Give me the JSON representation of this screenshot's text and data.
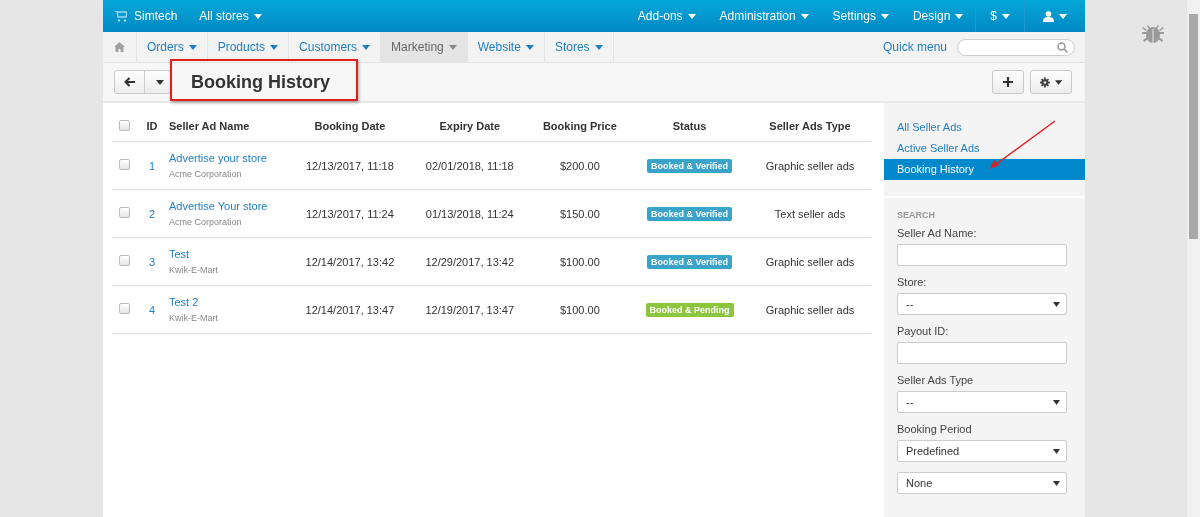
{
  "top_bar": {
    "brand": "Simtech",
    "store_switch": "All stores",
    "menus": [
      "Add-ons",
      "Administration",
      "Settings",
      "Design",
      "$"
    ]
  },
  "nav": {
    "items": [
      {
        "label": "Orders",
        "selected": false
      },
      {
        "label": "Products",
        "selected": false
      },
      {
        "label": "Customers",
        "selected": false
      },
      {
        "label": "Marketing",
        "selected": true
      },
      {
        "label": "Website",
        "selected": false
      },
      {
        "label": "Stores",
        "selected": false
      }
    ],
    "quick_menu": "Quick menu"
  },
  "page": {
    "title": "Booking History"
  },
  "table": {
    "select_all_checked": false,
    "columns": [
      "ID",
      "Seller Ad Name",
      "Booking Date",
      "Expiry Date",
      "Booking Price",
      "Status",
      "Seller Ads Type"
    ],
    "rows": [
      {
        "checked": false,
        "id": "1",
        "name": "Advertise your store",
        "company": "Acme Corporation",
        "booking_date": "12/13/2017, 11:18",
        "expiry_date": "02/01/2018, 11:18",
        "price": "$200.00",
        "status": {
          "label": "Booked & Verified",
          "color": "#3aa3c8"
        },
        "type": "Graphic seller ads"
      },
      {
        "checked": false,
        "id": "2",
        "name": "Advertise Your store",
        "company": "Acme Corporation",
        "booking_date": "12/13/2017, 11:24",
        "expiry_date": "01/13/2018, 11:24",
        "price": "$150.00",
        "status": {
          "label": "Booked & Verified",
          "color": "#3aa3c8"
        },
        "type": "Text seller ads"
      },
      {
        "checked": false,
        "id": "3",
        "name": "Test",
        "company": "Kwik-E-Mart",
        "booking_date": "12/14/2017, 13:42",
        "expiry_date": "12/29/2017, 13:42",
        "price": "$100.00",
        "status": {
          "label": "Booked & Verified",
          "color": "#3aa3c8"
        },
        "type": "Graphic seller ads"
      },
      {
        "checked": false,
        "id": "4",
        "name": "Test 2",
        "company": "Kwik-E-Mart",
        "booking_date": "12/14/2017, 13:47",
        "expiry_date": "12/19/2017, 13:47",
        "price": "$100.00",
        "status": {
          "label": "Booked & Pending",
          "color": "#8cc63f"
        },
        "type": "Graphic seller ads"
      }
    ]
  },
  "sidebar": {
    "links": [
      {
        "label": "All Seller Ads",
        "selected": false
      },
      {
        "label": "Active Seller Ads",
        "selected": false
      },
      {
        "label": "Booking History",
        "selected": true
      }
    ],
    "search": {
      "heading": "SEARCH",
      "fields": [
        {
          "kind": "text",
          "label": "Seller Ad Name:"
        },
        {
          "kind": "select",
          "label": "Store:",
          "value": "--"
        },
        {
          "kind": "text",
          "label": "Payout ID:"
        },
        {
          "kind": "select",
          "label": "Seller Ads Type",
          "value": "--"
        },
        {
          "kind": "select",
          "label": "Booking Period",
          "value": "Predefined"
        },
        {
          "kind": "select",
          "value": "None"
        }
      ]
    }
  }
}
